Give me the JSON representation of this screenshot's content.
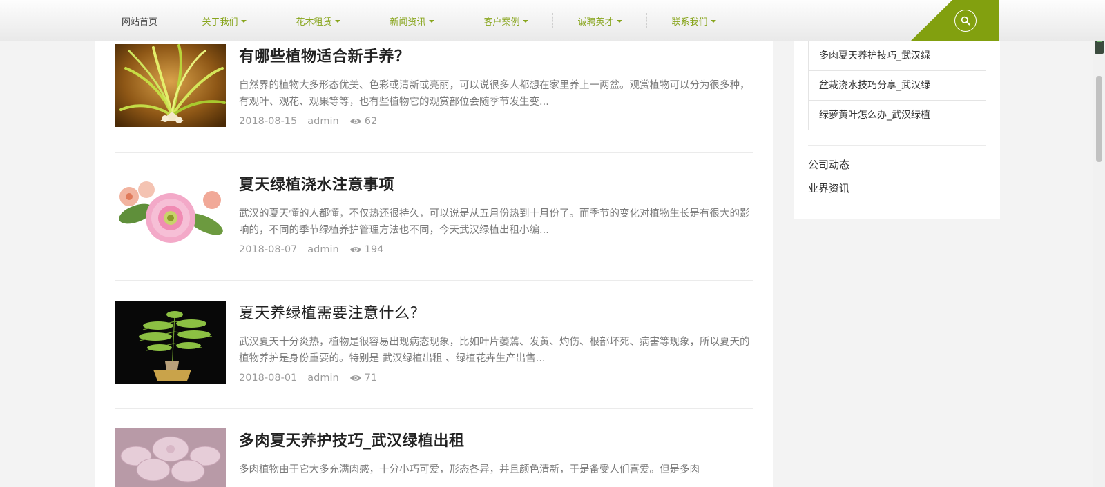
{
  "nav": {
    "home": "网站首页",
    "items": [
      "关于我们",
      "花木租赁",
      "新闻资讯",
      "客户案例",
      "诚聘英才",
      "联系我们"
    ]
  },
  "colors": {
    "accent": "#82a00f",
    "nav_text": "#88a51d"
  },
  "posts": [
    {
      "title": "有哪些植物适合新手养？",
      "excerpt": "自然界的植物大多形态优美、色彩或清新或亮丽，可以说很多人都想在家里养上一两盆。观赏植物可以分为很多种，有观叶、观花、观果等等，也有些植物它的观赏部位会随季节发生变...",
      "date": "2018-08-15",
      "author": "admin",
      "views": "62"
    },
    {
      "title": "夏天绿植浇水注意事项",
      "excerpt": "武汉的夏天懂的人都懂，不仅热还很持久，可以说是从五月份热到十月份了。而季节的变化对植物生长是有很大的影响的，不同的季节绿植养护管理方法也不同，今天武汉绿植出租小编...",
      "date": "2018-08-07",
      "author": "admin",
      "views": "194"
    },
    {
      "title": "夏天养绿植需要注意什么？",
      "excerpt": "武汉夏天十分炎热，植物是很容易出现病态现象，比如叶片萎蔫、发黄、灼伤、根部坏死、病害等现象，所以夏天的植物养护是身份重要的。特别是 武汉绿植出租 、绿植花卉生产出售...",
      "date": "2018-08-01",
      "author": "admin",
      "views": "71"
    },
    {
      "title": "多肉夏天养护技巧_武汉绿植出租",
      "excerpt": "多肉植物由于它大多充满肉感，十分小巧可爱，形态各异，并且颜色清新，于是备受人们喜爱。但是多肉"
    }
  ],
  "sidebar": {
    "related": [
      "多肉夏天养护技巧_武汉绿",
      "盆栽浇水技巧分享_武汉绿",
      "绿萝黄叶怎么办_武汉绿植"
    ],
    "categories": [
      "公司动态",
      "业界资讯"
    ]
  }
}
